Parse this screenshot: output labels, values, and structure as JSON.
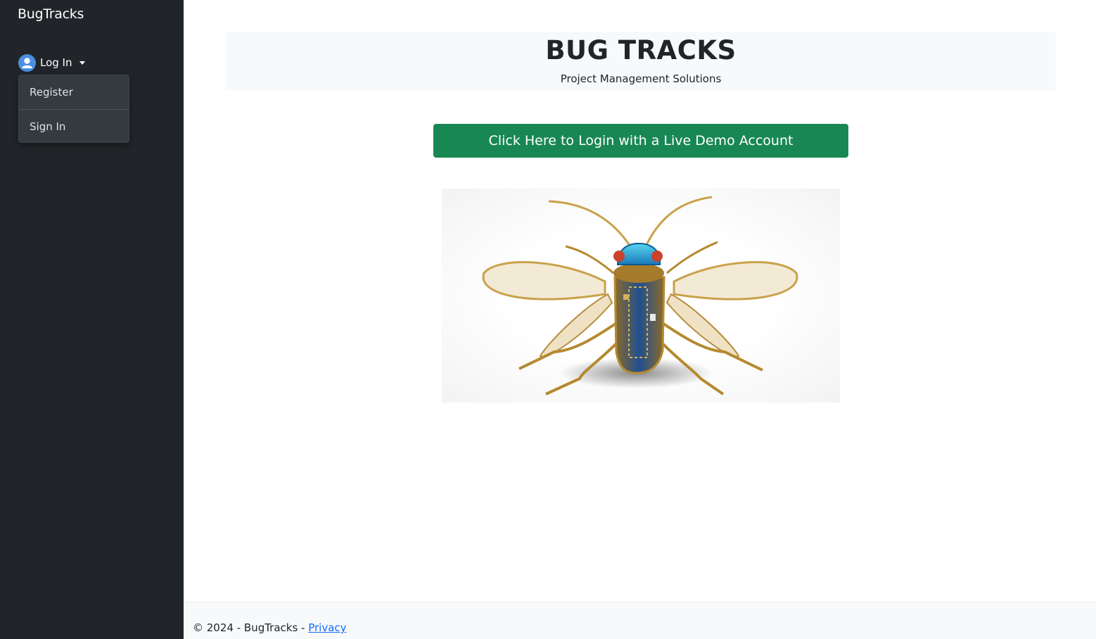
{
  "sidebar": {
    "brand": "BugTracks",
    "login_label": "Log In",
    "menu": [
      {
        "label": "Register"
      },
      {
        "label": "Sign In"
      }
    ]
  },
  "header": {
    "title": "BUG TRACKS",
    "subtitle": "Project Management Solutions"
  },
  "demo_button": {
    "label": "Click Here to Login with a Live Demo Account",
    "color": "#198754"
  },
  "footer": {
    "text": "© 2024 - BugTracks - ",
    "link": "Privacy"
  },
  "colors": {
    "sidebar_bg": "#212529",
    "link": "#0d6efd"
  }
}
